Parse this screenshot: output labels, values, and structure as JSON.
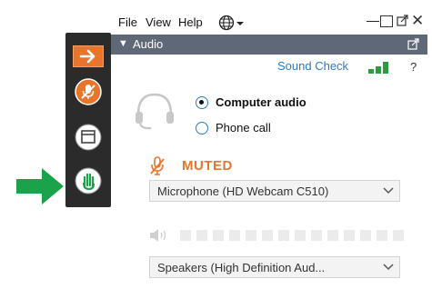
{
  "menubar": {
    "items": [
      {
        "label": "File"
      },
      {
        "label": "View"
      },
      {
        "label": "Help"
      }
    ],
    "window_controls": {
      "minimize": "—",
      "close": "✕"
    }
  },
  "audio_panel": {
    "title": "Audio",
    "sound_check": "Sound Check",
    "help": "?",
    "options": [
      {
        "label": "Computer audio",
        "selected": true
      },
      {
        "label": "Phone call",
        "selected": false
      }
    ],
    "mute_status": "MUTED",
    "microphone": {
      "selected": "Microphone (HD Webcam C510)"
    },
    "speakers": {
      "selected": "Speakers (High Definition Aud..."
    },
    "speaker_level": 0
  },
  "colors": {
    "header_bg": "#5e6876",
    "accent_orange": "#e8752b",
    "link_blue": "#2a7cc7",
    "signal_green": "#2a9d3c",
    "pointer_green": "#1aa34a",
    "strip_bg": "#2b2b2b"
  },
  "icons": [
    "collapse-arrow-icon",
    "microphone-muted-icon",
    "screen-share-icon",
    "raise-hand-icon",
    "globe-icon",
    "popout-icon",
    "headset-icon",
    "speaker-icon",
    "chevron-down-icon",
    "signal-bars-icon"
  ]
}
